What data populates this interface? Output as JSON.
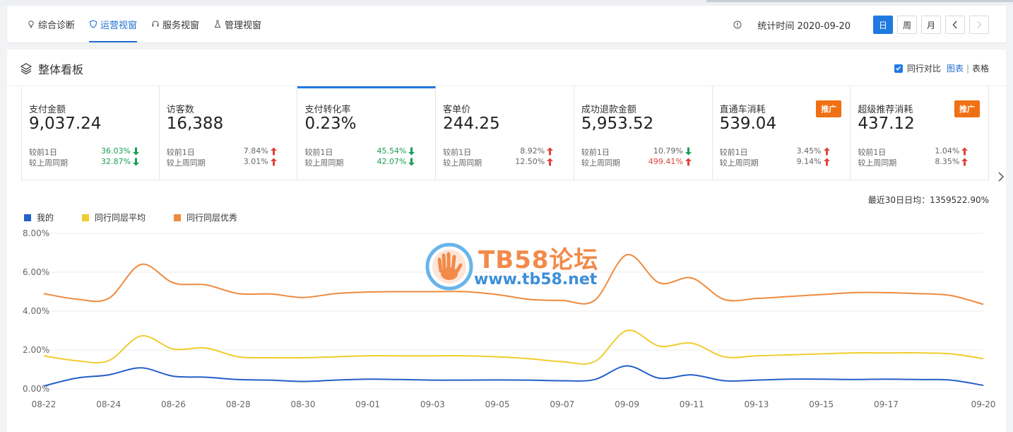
{
  "nav": {
    "tabs": [
      {
        "label": "综合诊断",
        "icon": "lightbulb-icon"
      },
      {
        "label": "运营视窗",
        "icon": "shield-icon",
        "active": true
      },
      {
        "label": "服务视窗",
        "icon": "headset-icon"
      },
      {
        "label": "管理视窗",
        "icon": "flask-icon"
      }
    ],
    "stat_time": "统计时间 2020-09-20",
    "period_buttons": [
      "日",
      "周",
      "月"
    ],
    "active_period": "日"
  },
  "panel": {
    "title": "整体看板",
    "compare_label": "同行对比",
    "view_chart": "图表",
    "view_sep": "|",
    "view_table": "表格"
  },
  "cards": [
    {
      "title": "支付金额",
      "value": "9,037.24",
      "r1_label": "较前1日",
      "r1_value": "36.03%",
      "r1_dir": "down",
      "r2_label": "较上周同期",
      "r2_value": "32.87%",
      "r2_dir": "down",
      "r1_color": "down",
      "r2_color": "down"
    },
    {
      "title": "访客数",
      "value": "16,388",
      "r1_label": "较前1日",
      "r1_value": "7.84%",
      "r1_dir": "up",
      "r2_label": "较上周同期",
      "r2_value": "3.01%",
      "r2_dir": "up",
      "r1_color": "plain",
      "r2_color": "plain"
    },
    {
      "title": "支付转化率",
      "value": "0.23%",
      "r1_label": "较前1日",
      "r1_value": "45.54%",
      "r1_dir": "down",
      "r2_label": "较上周同期",
      "r2_value": "42.07%",
      "r2_dir": "down",
      "r1_color": "down",
      "r2_color": "down",
      "active": true
    },
    {
      "title": "客单价",
      "value": "244.25",
      "r1_label": "较前1日",
      "r1_value": "8.92%",
      "r1_dir": "up",
      "r2_label": "较上周同期",
      "r2_value": "12.50%",
      "r2_dir": "up",
      "r1_color": "plain",
      "r2_color": "plain"
    },
    {
      "title": "成功退款金额",
      "value": "5,953.52",
      "r1_label": "较前1日",
      "r1_value": "10.79%",
      "r1_dir": "down",
      "r2_label": "较上周同期",
      "r2_value": "499.41%",
      "r2_dir": "up",
      "r1_color": "plain",
      "r2_color": "up"
    },
    {
      "title": "直通车消耗",
      "value": "539.04",
      "badge": "推广",
      "r1_label": "较前1日",
      "r1_value": "3.45%",
      "r1_dir": "up",
      "r2_label": "较上周同期",
      "r2_value": "9.14%",
      "r2_dir": "up",
      "r1_color": "plain",
      "r2_color": "plain"
    },
    {
      "title": "超级推荐消耗",
      "value": "437.12",
      "badge": "推广",
      "r1_label": "较前1日",
      "r1_value": "1.04%",
      "r1_dir": "up",
      "r2_label": "较上周同期",
      "r2_value": "8.35%",
      "r2_dir": "up",
      "r1_color": "plain",
      "r2_color": "plain"
    }
  ],
  "summary": "最近30日日均：1359522.90%",
  "watermark": {
    "line1": "TB58论坛",
    "line2": "www.tb58.net"
  },
  "colors": {
    "mine": "#2360c9",
    "avg": "#f0cc2e",
    "best": "#ee8a3e",
    "accent": "#1f7ae0",
    "up": "#e0433a",
    "down": "#1a9e55"
  },
  "chart_data": {
    "type": "line",
    "xlabel": "",
    "ylabel": "",
    "ylim": [
      0,
      8
    ],
    "yticks": [
      "0.00%",
      "2.00%",
      "4.00%",
      "6.00%",
      "8.00%"
    ],
    "grid": true,
    "legend_position": "top-left",
    "x": [
      "08-22",
      "08-23",
      "08-24",
      "08-25",
      "08-26",
      "08-27",
      "08-28",
      "08-29",
      "08-30",
      "08-31",
      "09-01",
      "09-02",
      "09-03",
      "09-04",
      "09-05",
      "09-06",
      "09-07",
      "09-08",
      "09-09",
      "09-10",
      "09-11",
      "09-12",
      "09-13",
      "09-14",
      "09-15",
      "09-16",
      "09-17",
      "09-18",
      "09-19",
      "09-20"
    ],
    "xticks": [
      "08-22",
      "08-24",
      "08-26",
      "08-28",
      "08-30",
      "09-01",
      "09-03",
      "09-05",
      "09-07",
      "09-09",
      "09-11",
      "09-13",
      "09-15",
      "09-17",
      "09-20"
    ],
    "series": [
      {
        "name": "我的",
        "values": [
          0.15,
          0.55,
          0.72,
          1.08,
          0.65,
          0.6,
          0.48,
          0.45,
          0.38,
          0.45,
          0.5,
          0.48,
          0.45,
          0.45,
          0.46,
          0.45,
          0.42,
          0.48,
          1.18,
          0.55,
          0.72,
          0.42,
          0.45,
          0.5,
          0.5,
          0.48,
          0.5,
          0.48,
          0.45,
          0.18
        ]
      },
      {
        "name": "同行同层平均",
        "values": [
          1.7,
          1.45,
          1.45,
          2.72,
          2.05,
          2.1,
          1.65,
          1.6,
          1.6,
          1.65,
          1.7,
          1.7,
          1.7,
          1.7,
          1.65,
          1.55,
          1.4,
          1.4,
          3.0,
          2.2,
          2.35,
          1.65,
          1.7,
          1.75,
          1.8,
          1.85,
          1.85,
          1.85,
          1.8,
          1.55
        ]
      },
      {
        "name": "同行同层优秀",
        "values": [
          4.9,
          4.62,
          4.65,
          6.4,
          5.45,
          5.35,
          4.9,
          4.88,
          4.7,
          4.9,
          4.98,
          5.0,
          5.0,
          5.0,
          4.85,
          4.6,
          4.55,
          4.55,
          6.9,
          5.45,
          5.7,
          4.6,
          4.65,
          4.75,
          4.85,
          4.95,
          4.95,
          4.9,
          4.8,
          4.35
        ]
      }
    ]
  }
}
